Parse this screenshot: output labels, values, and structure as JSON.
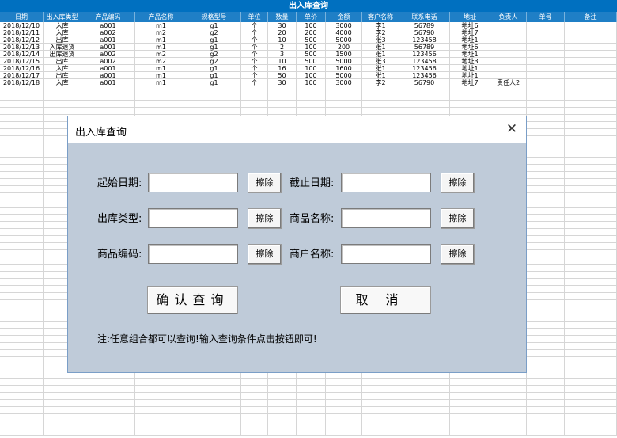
{
  "sheet": {
    "title": "出入库查询",
    "headers": [
      "日期",
      "出入库类型",
      "产品编码",
      "产品名称",
      "规格型号",
      "单位",
      "数量",
      "单价",
      "金额",
      "客户名称",
      "联系电话",
      "地址",
      "负责人",
      "单号",
      "备注"
    ],
    "rows": [
      [
        "2018/12/10",
        "入库",
        "a001",
        "m1",
        "g1",
        "个",
        "30",
        "100",
        "3000",
        "李1",
        "56789",
        "地址6",
        "",
        "",
        ""
      ],
      [
        "2018/12/11",
        "入库",
        "a002",
        "m2",
        "g2",
        "个",
        "20",
        "200",
        "4000",
        "李2",
        "56790",
        "地址7",
        "",
        "",
        ""
      ],
      [
        "2018/12/12",
        "出库",
        "a001",
        "m1",
        "g1",
        "个",
        "10",
        "500",
        "5000",
        "张3",
        "123458",
        "地址1",
        "",
        "",
        ""
      ],
      [
        "2018/12/13",
        "入库退货",
        "a001",
        "m1",
        "g1",
        "个",
        "2",
        "100",
        "200",
        "张1",
        "56789",
        "地址6",
        "",
        "",
        ""
      ],
      [
        "2018/12/14",
        "出库退货",
        "a002",
        "m2",
        "g2",
        "个",
        "3",
        "500",
        "1500",
        "张1",
        "123456",
        "地址1",
        "",
        "",
        ""
      ],
      [
        "2018/12/15",
        "出库",
        "a002",
        "m2",
        "g2",
        "个",
        "10",
        "500",
        "5000",
        "张3",
        "123458",
        "地址3",
        "",
        "",
        ""
      ],
      [
        "2018/12/16",
        "入库",
        "a001",
        "m1",
        "g1",
        "个",
        "16",
        "100",
        "1600",
        "张1",
        "123456",
        "地址1",
        "",
        "",
        ""
      ],
      [
        "2018/12/17",
        "出库",
        "a001",
        "m1",
        "g1",
        "个",
        "50",
        "100",
        "5000",
        "张1",
        "123456",
        "地址1",
        "",
        "",
        ""
      ],
      [
        "2018/12/18",
        "入库",
        "a001",
        "m1",
        "g1",
        "个",
        "30",
        "100",
        "3000",
        "李2",
        "56790",
        "地址7",
        "责任人2",
        "",
        ""
      ]
    ]
  },
  "dialog": {
    "title": "出入库查询",
    "close": "✕",
    "fields": {
      "start_date": {
        "label": "起始日期:",
        "value": "",
        "clear": "擦除"
      },
      "end_date": {
        "label": "截止日期:",
        "value": "",
        "clear": "擦除"
      },
      "out_type": {
        "label": "出库类型:",
        "value": "",
        "clear": "擦除"
      },
      "product_name": {
        "label": "商品名称:",
        "value": "",
        "clear": "擦除"
      },
      "product_code": {
        "label": "商品编码:",
        "value": "",
        "clear": "擦除"
      },
      "customer_name": {
        "label": "商户名称:",
        "value": "",
        "clear": "擦除"
      }
    },
    "confirm": "确认查询",
    "cancel": "取消",
    "note": "注:任意组合都可以查询!输入查询条件点击按钮即可!"
  }
}
